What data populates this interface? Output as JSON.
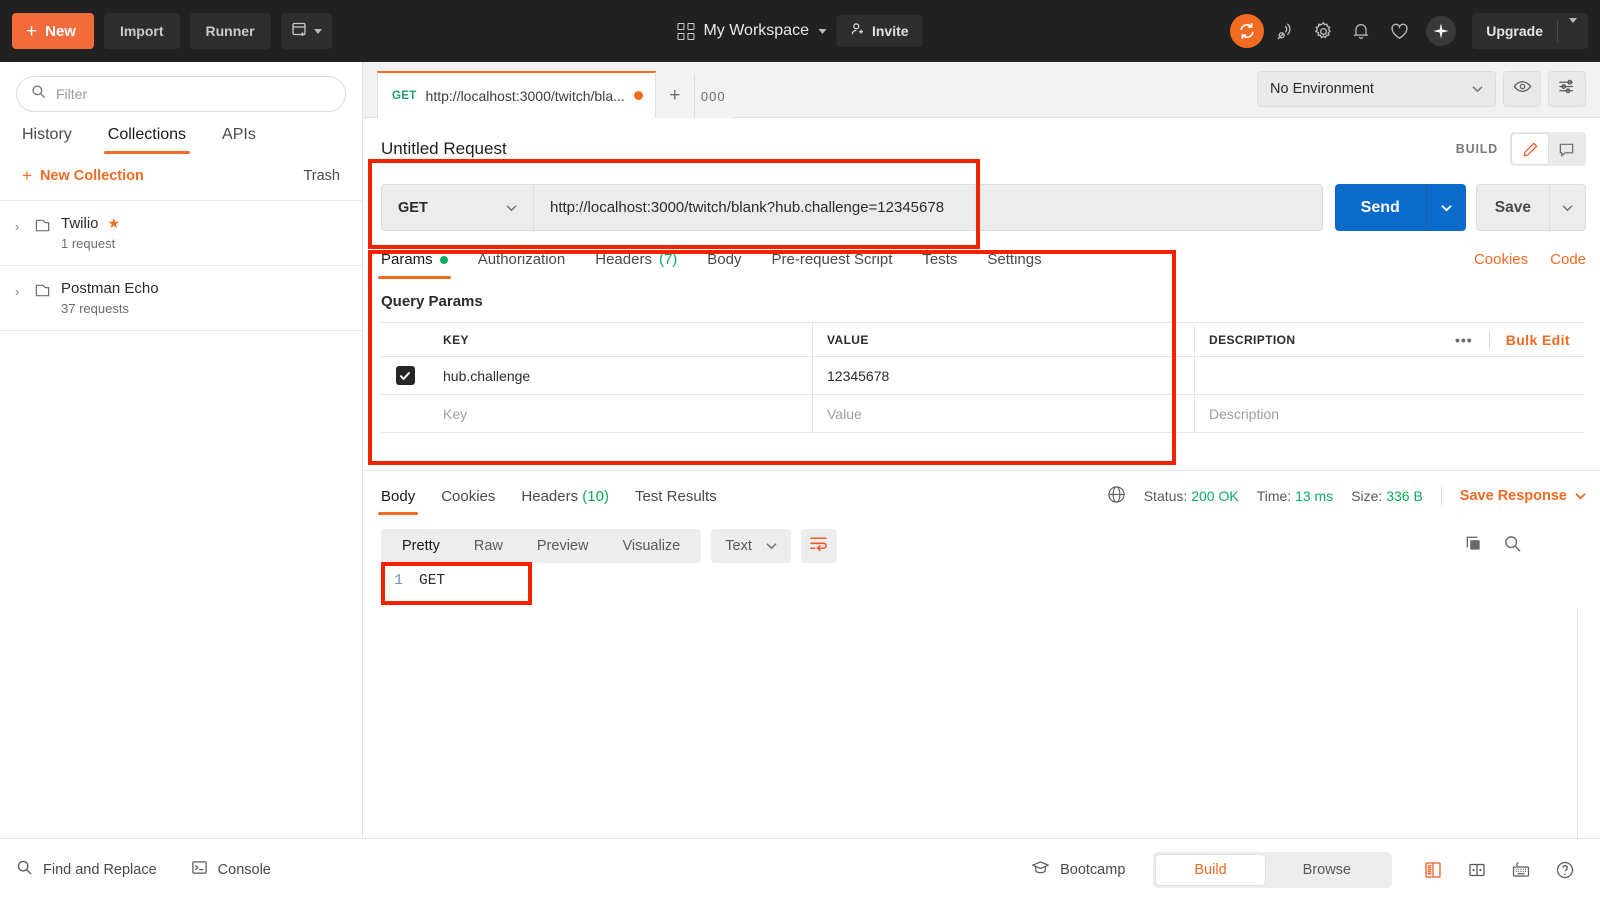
{
  "header": {
    "new_button": "New",
    "new_plus": "+",
    "import_button": "Import",
    "runner_button": "Runner",
    "workspace_name": "My Workspace",
    "invite_button": "Invite",
    "upgrade_button": "Upgrade",
    "icons": [
      "sync-icon",
      "satellite-icon",
      "gear-icon",
      "bell-icon",
      "heart-icon",
      "sparkle-icon"
    ],
    "accent_color": "#f26b22",
    "background_color": "#212121"
  },
  "sidebar": {
    "filter_placeholder": "Filter",
    "tabs": [
      {
        "label": "History",
        "active": false
      },
      {
        "label": "Collections",
        "active": true
      },
      {
        "label": "APIs",
        "active": false
      }
    ],
    "new_collection": "New Collection",
    "new_collection_plus": "+",
    "trash": "Trash",
    "collections": [
      {
        "name": "Twilio",
        "count": "1 request",
        "starred": true,
        "star": "★",
        "chevron": "›"
      },
      {
        "name": "Postman Echo",
        "count": "37 requests",
        "starred": false,
        "star": "",
        "chevron": "›"
      }
    ]
  },
  "tabstrip": {
    "request_tab": {
      "method": "GET",
      "url_truncated": "http://localhost:3000/twitch/bla...",
      "unsaved": true
    },
    "add_tab": "+",
    "more_tabs": "000",
    "environment": "No Environment"
  },
  "request": {
    "title": "Untitled Request",
    "build_label": "BUILD",
    "method": "GET",
    "url": "http://localhost:3000/twitch/blank?hub.challenge=12345678",
    "send_button": "Send",
    "save_button": "Save",
    "tabs": [
      {
        "label": "Params",
        "active": true,
        "dot": true,
        "count": ""
      },
      {
        "label": "Authorization",
        "active": false,
        "dot": false,
        "count": ""
      },
      {
        "label": "Headers",
        "active": false,
        "dot": false,
        "count": "(7)"
      },
      {
        "label": "Body",
        "active": false,
        "dot": false,
        "count": ""
      },
      {
        "label": "Pre-request Script",
        "active": false,
        "dot": false,
        "count": ""
      },
      {
        "label": "Tests",
        "active": false,
        "dot": false,
        "count": ""
      },
      {
        "label": "Settings",
        "active": false,
        "dot": false,
        "count": ""
      }
    ],
    "cookies_link": "Cookies",
    "code_link": "Code",
    "query_params_label": "Query Params",
    "table": {
      "headers": {
        "key": "KEY",
        "value": "VALUE",
        "description": "DESCRIPTION"
      },
      "dots": "•••",
      "bulk_edit": "Bulk Edit",
      "rows": [
        {
          "checked": true,
          "check_glyph": "✔",
          "key": "hub.challenge",
          "value": "12345678",
          "description": ""
        }
      ],
      "placeholder_row": {
        "key": "Key",
        "value": "Value",
        "description": "Description"
      }
    }
  },
  "response": {
    "tabs": [
      {
        "label": "Body",
        "active": true,
        "count": ""
      },
      {
        "label": "Cookies",
        "active": false,
        "count": ""
      },
      {
        "label": "Headers",
        "active": false,
        "count": "(10)"
      },
      {
        "label": "Test Results",
        "active": false,
        "count": ""
      }
    ],
    "status_label": "Status:",
    "status_value": "200 OK",
    "time_label": "Time:",
    "time_value": "13 ms",
    "size_label": "Size:",
    "size_value": "336 B",
    "save_response": "Save Response",
    "view_modes": [
      {
        "label": "Pretty",
        "active": true
      },
      {
        "label": "Raw",
        "active": false
      },
      {
        "label": "Preview",
        "active": false
      },
      {
        "label": "Visualize",
        "active": false
      }
    ],
    "format": "Text",
    "body_lines": [
      {
        "number": "1",
        "text": "GET"
      }
    ]
  },
  "bottombar": {
    "find_replace": "Find and Replace",
    "console": "Console",
    "bootcamp": "Bootcamp",
    "mode_toggle": [
      {
        "label": "Build",
        "active": true
      },
      {
        "label": "Browse",
        "active": false
      }
    ]
  }
}
